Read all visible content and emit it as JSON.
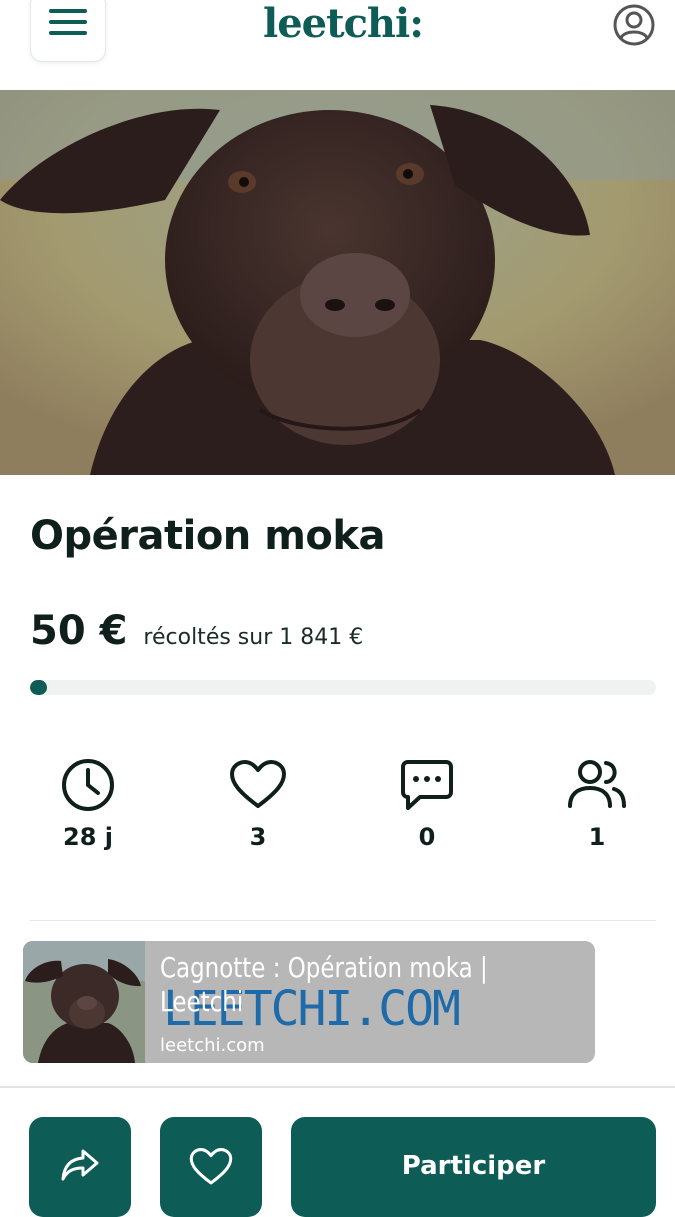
{
  "header": {
    "logo": "leetchi:"
  },
  "campaign": {
    "title": "Opération moka",
    "raised": "50 €",
    "raised_suffix": "récoltés sur 1 841 €",
    "progress_fraction": 0.027
  },
  "stats": [
    {
      "icon": "clock-icon",
      "value": "28 j"
    },
    {
      "icon": "heart-icon",
      "value": "3"
    },
    {
      "icon": "comment-icon",
      "value": "0"
    },
    {
      "icon": "users-icon",
      "value": "1"
    }
  ],
  "link_preview": {
    "title": "Cagnotte : Opération moka | Leetchi",
    "background_text": "LEETCHI.COM",
    "domain": "leetchi.com"
  },
  "actions": {
    "participate_label": "Participer"
  },
  "colors": {
    "brand": "#0d5c55",
    "text": "#0f1f1c",
    "progress_track": "#f0f1f1"
  }
}
